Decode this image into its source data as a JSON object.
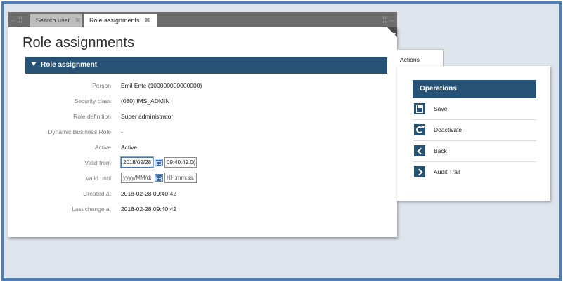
{
  "tabs": [
    {
      "label": "Search user",
      "active": false
    },
    {
      "label": "Role assignments",
      "active": true
    }
  ],
  "page_title": "Role assignments",
  "section": {
    "title": "Role assignment"
  },
  "fields": {
    "person": {
      "label": "Person",
      "value": "Emil Ente (100000000000000)"
    },
    "security_class": {
      "label": "Security class",
      "value": "(080) IMS_ADMIN"
    },
    "role_definition": {
      "label": "Role definition",
      "value": "Super administrator"
    },
    "dynamic_business_role": {
      "label": "Dynamic Business Role",
      "value": "-"
    },
    "active": {
      "label": "Active",
      "value": "Active"
    },
    "valid_from": {
      "label": "Valid from",
      "date": "2018/02/28",
      "time": "09:40:42.0("
    },
    "valid_until": {
      "label": "Valid until",
      "date_placeholder": "yyyy/MM/dd",
      "time_placeholder": "HH:mm:ss."
    },
    "created_at": {
      "label": "Created at",
      "value": "2018-02-28 09:40:42"
    },
    "last_change_at": {
      "label": "Last change at",
      "value": "2018-02-28 09:40:42"
    }
  },
  "actions": {
    "tab_label": "Actions",
    "header": "Operations",
    "items": [
      {
        "label": "Save",
        "icon": "save-icon"
      },
      {
        "label": "Deactivate",
        "icon": "refresh-icon"
      },
      {
        "label": "Back",
        "icon": "chevron-left-icon"
      },
      {
        "label": "Audit Trail",
        "icon": "chevron-right-icon"
      }
    ]
  },
  "colors": {
    "accent": "#255275",
    "frame": "#4a7fc0",
    "background": "#dee4ec",
    "tab_strip": "#6d6d6d"
  }
}
